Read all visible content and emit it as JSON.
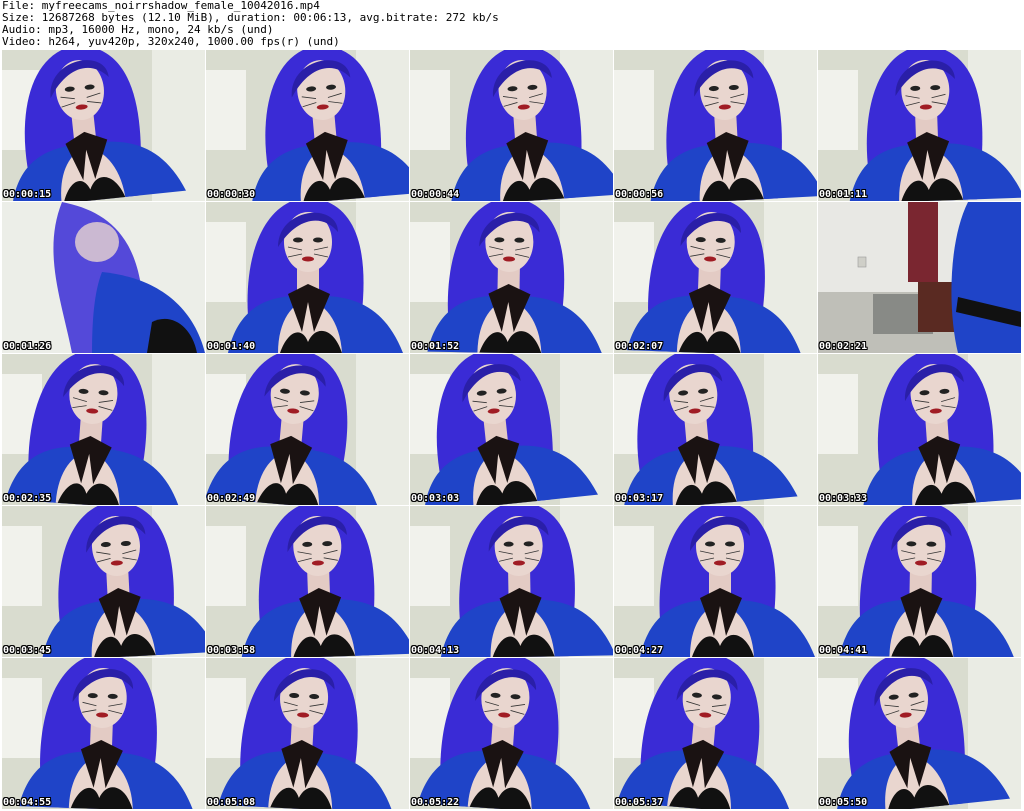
{
  "header": {
    "file_line": "File: myfreecams_noirrshadow_female_10042016.mp4",
    "size_line": "Size: 12687268 bytes (12.10 MiB), duration: 00:06:13, avg.bitrate: 272 kb/s",
    "audio_line": "Audio: mp3, 16000 Hz, mono, 24 kb/s (und)",
    "video_line": "Video: h264, yuv420p, 320x240, 1000.00 fps(r) (und)"
  },
  "colors": {
    "wig": "#3a2bd6",
    "wig_dark": "#2a1fa8",
    "top": "#1f44c8",
    "bra": "#111111",
    "bow": "#1a1212",
    "skin": "#e9d6cf",
    "background": "#d9dccf",
    "room_wall": "#e8e8e4"
  },
  "thumbnails": [
    {
      "timestamp": "00:00:15",
      "scene": "portrait"
    },
    {
      "timestamp": "00:00:30",
      "scene": "portrait"
    },
    {
      "timestamp": "00:00:44",
      "scene": "portrait"
    },
    {
      "timestamp": "00:00:56",
      "scene": "portrait"
    },
    {
      "timestamp": "00:01:11",
      "scene": "portrait"
    },
    {
      "timestamp": "00:01:26",
      "scene": "blurred"
    },
    {
      "timestamp": "00:01:40",
      "scene": "portrait"
    },
    {
      "timestamp": "00:01:52",
      "scene": "portrait"
    },
    {
      "timestamp": "00:02:07",
      "scene": "portrait"
    },
    {
      "timestamp": "00:02:21",
      "scene": "room"
    },
    {
      "timestamp": "00:02:35",
      "scene": "portrait"
    },
    {
      "timestamp": "00:02:49",
      "scene": "portrait"
    },
    {
      "timestamp": "00:03:03",
      "scene": "portrait"
    },
    {
      "timestamp": "00:03:17",
      "scene": "portrait"
    },
    {
      "timestamp": "00:03:33",
      "scene": "portrait"
    },
    {
      "timestamp": "00:03:45",
      "scene": "portrait"
    },
    {
      "timestamp": "00:03:58",
      "scene": "portrait"
    },
    {
      "timestamp": "00:04:13",
      "scene": "portrait"
    },
    {
      "timestamp": "00:04:27",
      "scene": "portrait"
    },
    {
      "timestamp": "00:04:41",
      "scene": "portrait"
    },
    {
      "timestamp": "00:04:55",
      "scene": "portrait"
    },
    {
      "timestamp": "00:05:08",
      "scene": "portrait"
    },
    {
      "timestamp": "00:05:22",
      "scene": "portrait"
    },
    {
      "timestamp": "00:05:37",
      "scene": "portrait"
    },
    {
      "timestamp": "00:05:50",
      "scene": "portrait"
    }
  ]
}
